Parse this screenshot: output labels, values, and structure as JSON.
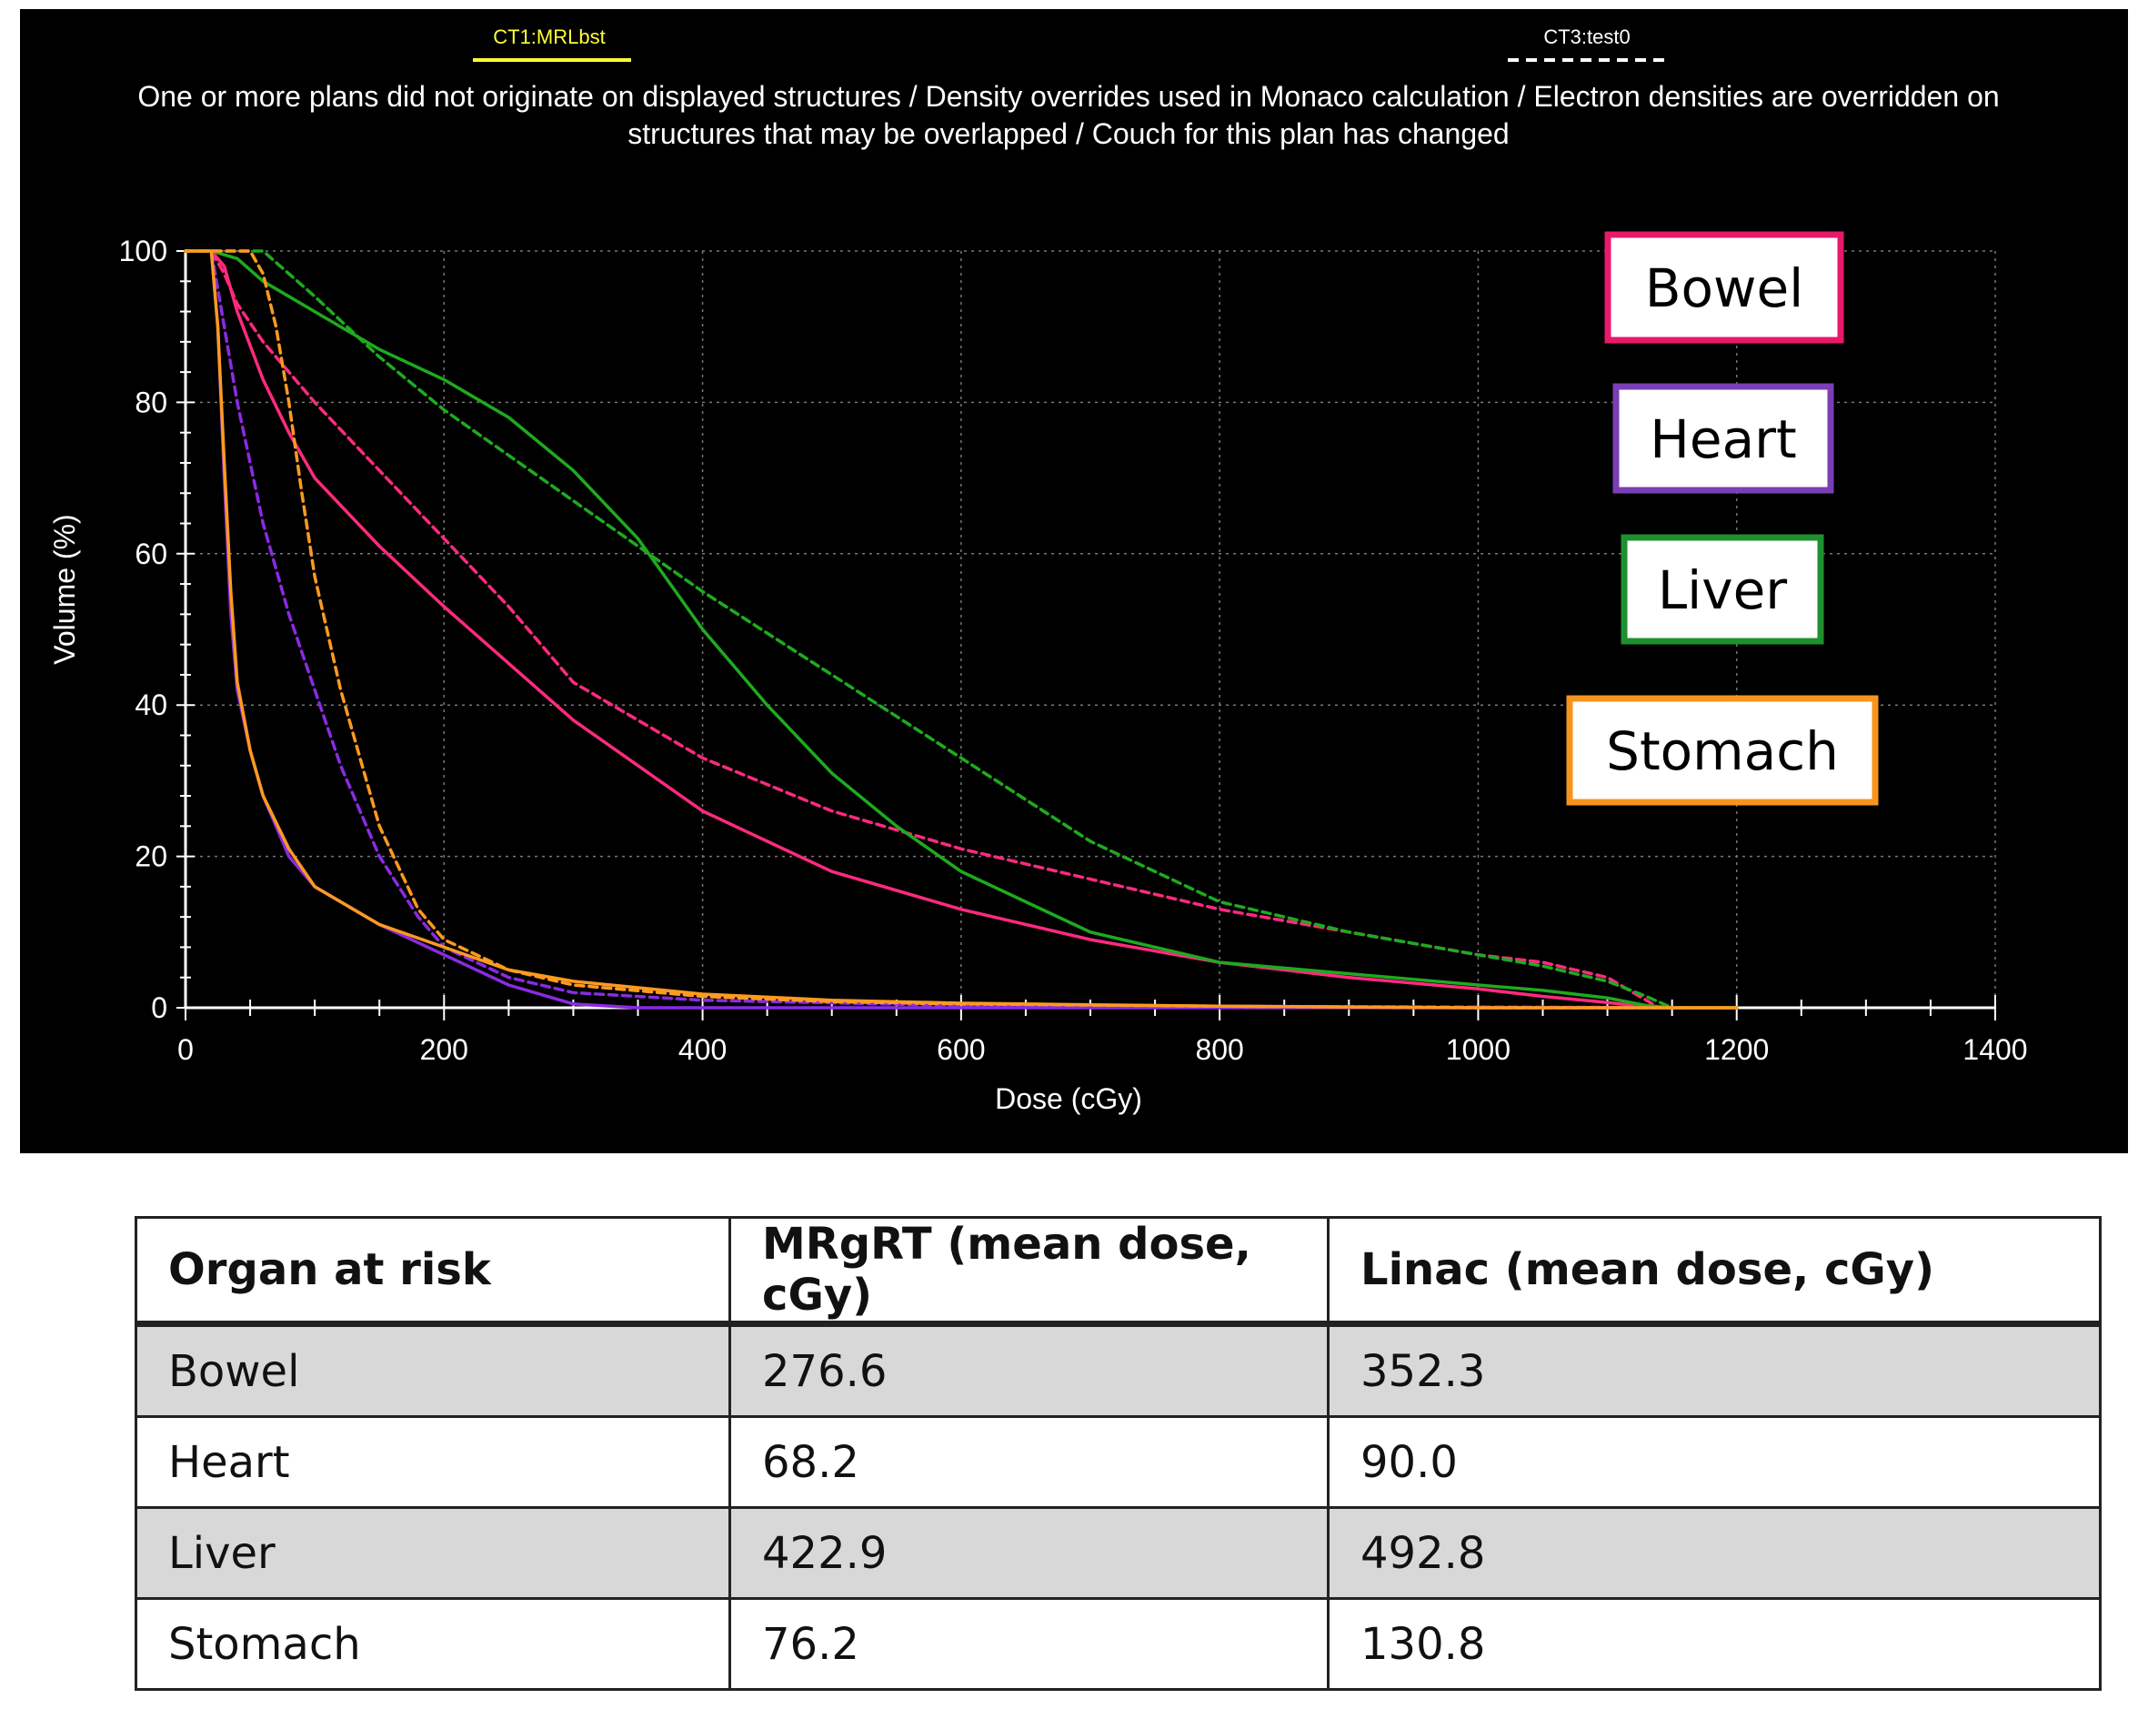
{
  "chart_data": {
    "type": "line",
    "plan_tags": [
      {
        "label": "CT1:MRLbst",
        "color": "#ffff33",
        "line_style": "solid"
      },
      {
        "label": "CT3:test0",
        "color": "#ffffff",
        "line_style": "dashed"
      }
    ],
    "warning_lines": [
      "One or more plans did not originate on displayed structures / Density overrides used in Monaco calculation / Electron densities are overridden on",
      "structures that may be overlapped / Couch for this plan has changed"
    ],
    "xlabel": "Dose (cGy)",
    "ylabel": "Volume (%)",
    "xlim": [
      0,
      1400
    ],
    "ylim": [
      0,
      100
    ],
    "xticks": [
      "0",
      "200",
      "400",
      "600",
      "800",
      "1000",
      "1200",
      "1400"
    ],
    "yticks": [
      "0",
      "20",
      "40",
      "60",
      "80",
      "100"
    ],
    "grid": true,
    "legend_position": "right",
    "series": [
      {
        "name": "Bowel",
        "color": "#ff2a7f",
        "plan": "CT1:MRLbst",
        "style": "solid",
        "x": [
          0,
          20,
          30,
          40,
          60,
          80,
          100,
          150,
          200,
          300,
          400,
          500,
          600,
          700,
          800,
          900,
          1000,
          1050,
          1100,
          1130,
          1150,
          1200
        ],
        "y": [
          100,
          100,
          98,
          92,
          83,
          76,
          70,
          61,
          53,
          38,
          26,
          18,
          13,
          9,
          6,
          4,
          2.5,
          1.5,
          0.7,
          0.1,
          0,
          0
        ]
      },
      {
        "name": "Bowel",
        "color": "#ff2a7f",
        "plan": "CT3:test0",
        "style": "dashed",
        "x": [
          0,
          20,
          30,
          40,
          60,
          100,
          150,
          200,
          250,
          300,
          400,
          500,
          600,
          700,
          800,
          900,
          1000,
          1050,
          1100,
          1120,
          1140,
          1200
        ],
        "y": [
          100,
          100,
          97,
          93,
          88,
          80,
          71,
          62,
          53,
          43,
          33,
          26,
          21,
          17,
          13,
          10,
          7,
          6,
          4,
          2,
          0,
          0
        ]
      },
      {
        "name": "Heart",
        "color": "#8a2be2",
        "plan": "CT1:MRLbst",
        "style": "solid",
        "x": [
          0,
          20,
          25,
          30,
          35,
          40,
          50,
          60,
          80,
          100,
          150,
          200,
          250,
          300,
          350,
          400,
          600,
          1200
        ],
        "y": [
          100,
          100,
          90,
          70,
          52,
          42,
          34,
          28,
          20,
          16,
          11,
          7,
          3,
          0.5,
          0,
          0,
          0,
          0
        ]
      },
      {
        "name": "Heart",
        "color": "#8a2be2",
        "plan": "CT3:test0",
        "style": "dashed",
        "x": [
          0,
          20,
          30,
          40,
          50,
          60,
          80,
          100,
          120,
          150,
          180,
          200,
          250,
          300,
          400,
          600,
          1200
        ],
        "y": [
          100,
          100,
          90,
          80,
          72,
          64,
          52,
          42,
          32,
          20,
          12,
          8,
          4,
          2,
          1,
          0.3,
          0
        ]
      },
      {
        "name": "Liver",
        "color": "#1faa1f",
        "plan": "CT1:MRLbst",
        "style": "solid",
        "x": [
          0,
          20,
          40,
          60,
          100,
          150,
          200,
          250,
          300,
          350,
          400,
          450,
          500,
          550,
          600,
          700,
          800,
          900,
          1000,
          1050,
          1100,
          1130,
          1150,
          1200
        ],
        "y": [
          100,
          100,
          99,
          96,
          92,
          87,
          83,
          78,
          71,
          62,
          50,
          40,
          31,
          24,
          18,
          10,
          6,
          4.5,
          3,
          2.3,
          1.3,
          0.3,
          0,
          0
        ]
      },
      {
        "name": "Liver",
        "color": "#1faa1f",
        "plan": "CT3:test0",
        "style": "dashed",
        "x": [
          0,
          40,
          60,
          80,
          100,
          150,
          200,
          300,
          400,
          500,
          600,
          700,
          800,
          900,
          1000,
          1050,
          1100,
          1130,
          1150,
          1200
        ],
        "y": [
          100,
          100,
          100,
          97,
          94,
          86,
          79,
          67,
          55,
          44,
          33,
          22,
          14,
          10,
          7,
          5.5,
          3.5,
          1.5,
          0,
          0
        ]
      },
      {
        "name": "Stomach",
        "color": "#ff9a1f",
        "plan": "CT1:MRLbst",
        "style": "solid",
        "x": [
          0,
          20,
          25,
          30,
          35,
          40,
          50,
          60,
          80,
          100,
          150,
          200,
          250,
          300,
          400,
          500,
          600,
          700,
          800,
          1000,
          1200
        ],
        "y": [
          100,
          100,
          90,
          72,
          55,
          43,
          34,
          28,
          21,
          16,
          11,
          8,
          5,
          3.5,
          1.8,
          1,
          0.6,
          0.4,
          0.2,
          0,
          0
        ]
      },
      {
        "name": "Stomach",
        "color": "#ff9a1f",
        "plan": "CT3:test0",
        "style": "dashed",
        "x": [
          0,
          50,
          60,
          70,
          80,
          90,
          100,
          120,
          150,
          180,
          200,
          250,
          300,
          400,
          500,
          600,
          800,
          1000,
          1200
        ],
        "y": [
          100,
          100,
          97,
          90,
          80,
          68,
          57,
          42,
          24,
          13,
          9,
          5,
          3,
          1.5,
          0.8,
          0.5,
          0.2,
          0,
          0
        ]
      }
    ],
    "legend": [
      {
        "label": "Bowel",
        "color": "#e8196b"
      },
      {
        "label": "Heart",
        "color": "#7a3fb5"
      },
      {
        "label": "Liver",
        "color": "#1f8f2f"
      },
      {
        "label": "Stomach",
        "color": "#f7941d"
      }
    ]
  },
  "table": {
    "headers": [
      "Organ at risk",
      "MRgRT (mean dose, cGy)",
      "Linac (mean dose, cGy)"
    ],
    "rows": [
      [
        "Bowel",
        "276.6",
        "352.3"
      ],
      [
        "Heart",
        "68.2",
        "90.0"
      ],
      [
        "Liver",
        "422.9",
        "492.8"
      ],
      [
        "Stomach",
        "76.2",
        "130.8"
      ]
    ]
  }
}
